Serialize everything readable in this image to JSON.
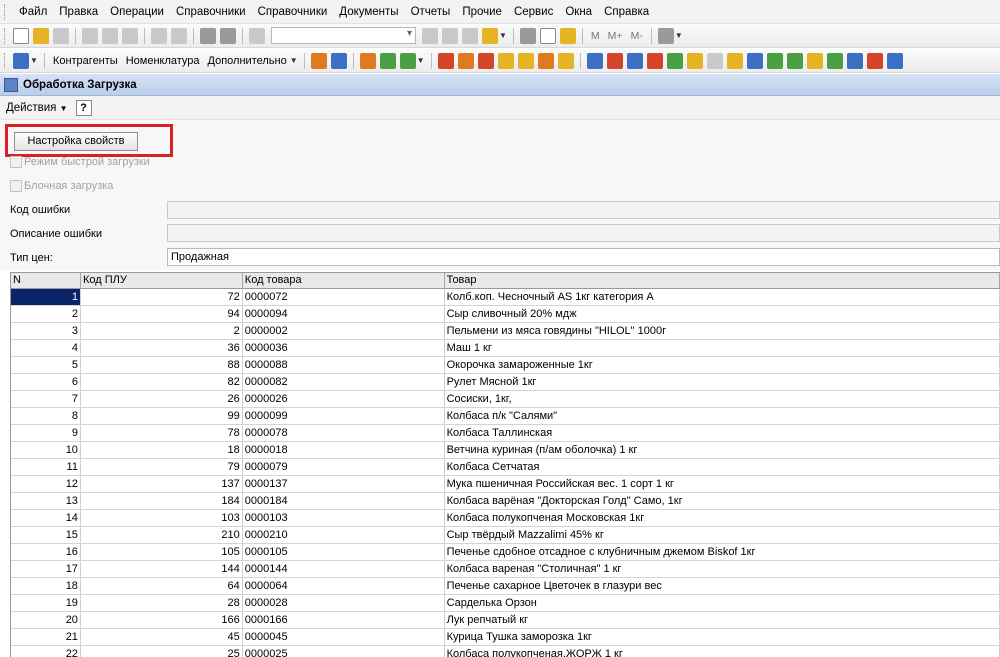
{
  "menu": [
    "Файл",
    "Правка",
    "Операции",
    "Справочники",
    "Справочники",
    "Документы",
    "Отчеты",
    "Прочие",
    "Сервис",
    "Окна",
    "Справка"
  ],
  "toolbar": {
    "memory_buttons": [
      "M",
      "M+",
      "M-"
    ],
    "links": [
      "Контрагенты",
      "Номенклатура",
      "Дополнительно"
    ]
  },
  "window": {
    "title": "Обработка  Загрузка"
  },
  "actions": {
    "label": "Действия",
    "help": "?"
  },
  "form": {
    "settings_button": "Настройка свойств",
    "fast_load_label": "Режим быстрой загрузки",
    "block_load_label": "Блочная загрузка",
    "error_code_label": "Код ошибки",
    "error_desc_label": "Описание ошибки",
    "price_type_label": "Тип цен:",
    "price_type_value": "Продажная"
  },
  "table": {
    "columns": [
      "N",
      "Код ПЛУ",
      "Код товара",
      "Товар"
    ],
    "rows": [
      [
        "1",
        "72",
        "0000072",
        "Колб.коп. Чесночный AS 1кг категория А"
      ],
      [
        "2",
        "94",
        "0000094",
        "Сыр сливочный 20% мдж"
      ],
      [
        "3",
        "2",
        "0000002",
        "Пельмени из мяса говядины \"HILOL\" 1000г"
      ],
      [
        "4",
        "36",
        "0000036",
        "Маш 1 кг"
      ],
      [
        "5",
        "88",
        "0000088",
        "Окорочка замароженные 1кг"
      ],
      [
        "6",
        "82",
        "0000082",
        "Рулет Мясной 1кг"
      ],
      [
        "7",
        "26",
        "0000026",
        "Сосиски, 1кг,"
      ],
      [
        "8",
        "99",
        "0000099",
        "Колбаса п/к \"Салями\""
      ],
      [
        "9",
        "78",
        "0000078",
        "Колбаса Таллинская"
      ],
      [
        "10",
        "18",
        "0000018",
        "Ветчина куриная (п/ам оболочка) 1 кг"
      ],
      [
        "11",
        "79",
        "0000079",
        "Колбаса Сетчатая"
      ],
      [
        "12",
        "137",
        "0000137",
        "Мука пшеничная Российская вес. 1 сорт 1 кг"
      ],
      [
        "13",
        "184",
        "0000184",
        "Колбаса варёная \"Докторская Голд\" Само, 1кг"
      ],
      [
        "14",
        "103",
        "0000103",
        "Колбаса полукопченая Московская 1кг"
      ],
      [
        "15",
        "210",
        "0000210",
        "Сыр твёрдый Mazzalimi 45% кг"
      ],
      [
        "16",
        "105",
        "0000105",
        "Печенье сдобное отсадное с клубничным джемом Biskof 1кг"
      ],
      [
        "17",
        "144",
        "0000144",
        "Колбаса вареная \"Столичная\" 1 кг"
      ],
      [
        "18",
        "64",
        "0000064",
        "Печенье сахарное Цветочек в глазури вес"
      ],
      [
        "19",
        "28",
        "0000028",
        "Сарделька Орзон"
      ],
      [
        "20",
        "166",
        "0000166",
        "Лук репчатый кг"
      ],
      [
        "21",
        "45",
        "0000045",
        "Курица Тушка заморозка 1кг"
      ],
      [
        "22",
        "25",
        "0000025",
        "Колбаса полукопченая,ЖОРЖ 1 кг"
      ]
    ]
  }
}
